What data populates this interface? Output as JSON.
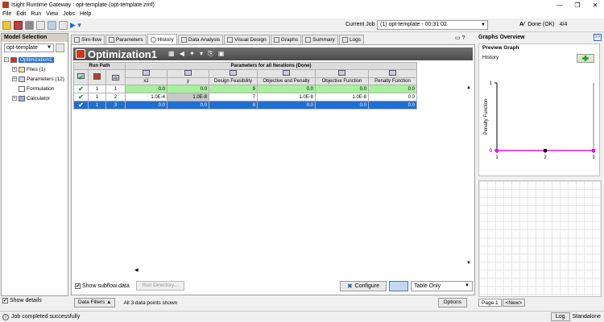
{
  "window": {
    "title": "Isight Runtime Gateway : opt-template (opt-template.zmf)",
    "min": "—",
    "max": "❐",
    "close": "✕"
  },
  "menu": [
    "File",
    "Edit",
    "Run",
    "View",
    "Jobs",
    "Help"
  ],
  "toolbar": {
    "current_job_label": "Current Job",
    "current_job_value": "(1) opt-template - 00:31:02",
    "status": "Done (OK)",
    "status_count": "4/4"
  },
  "model_selection": {
    "header": "Model Selection",
    "selected": "opt-template",
    "tree": [
      {
        "label": "Optimization1",
        "selected": true
      },
      {
        "label": "Files (1)"
      },
      {
        "label": "Parameters (12)"
      },
      {
        "label": "Formulation"
      },
      {
        "label": "Calculator"
      }
    ],
    "show_details": "Show details"
  },
  "tabs": [
    "Sim-flow",
    "Parameters",
    "History",
    "Data Analysis",
    "Visual Design",
    "Graphs",
    "Summary",
    "Logs"
  ],
  "history": {
    "title": "Optimization1",
    "run_path_header": "Run Path",
    "params_header": "Parameters for all Iterations (Done)",
    "columns": [
      "x1",
      "y",
      "Design Feasibility",
      "Objective and Penalty",
      "Objective Function",
      "Penalty Function"
    ],
    "rows": [
      {
        "check": "✔",
        "run": "1",
        "iter": "1",
        "x1": "0.0",
        "y": "0.0",
        "feas": "9",
        "obj_pen": "0.0",
        "obj": "0.0",
        "pen": "0.0"
      },
      {
        "check": "✔",
        "run": "1",
        "iter": "2",
        "x1": "1.0E-4",
        "y": "1.0E-8",
        "feas": "7",
        "obj_pen": "1.0E-8",
        "obj": "1.0E-8",
        "pen": "0.0"
      },
      {
        "check": "✔",
        "run": "1",
        "iter": "3",
        "x1": "0.0",
        "y": "0.0",
        "feas": "8",
        "obj_pen": "0.0",
        "obj": "0.0",
        "pen": "0.0"
      }
    ],
    "show_subflow": "Show subflow data",
    "run_directory": "Run Directory...",
    "configure": "Configure",
    "view_mode": "Table Only",
    "data_filters": "Data Filters ▲",
    "point_count": "All 3 data points shown",
    "options": "Options"
  },
  "graphs": {
    "header": "Graphs Overview",
    "preview_header": "Preview Graph",
    "history_label": "History",
    "page_tabs": [
      "Page 1",
      "<New>"
    ]
  },
  "chart_data": {
    "type": "line",
    "x": [
      1,
      2,
      3
    ],
    "y": [
      0,
      0,
      0
    ],
    "xlabel": "",
    "ylabel": "Penalty Function",
    "xlim": [
      1,
      3
    ],
    "ylim": [
      0,
      1
    ],
    "xticks": [
      "1",
      "2",
      "3"
    ],
    "yticks": [
      "0",
      "1"
    ],
    "color": "#ff00ff",
    "selected_point_color": "#000000"
  },
  "statusbar": {
    "message": "Job completed successfully",
    "log_button": "Log",
    "mode": "Standalone"
  }
}
